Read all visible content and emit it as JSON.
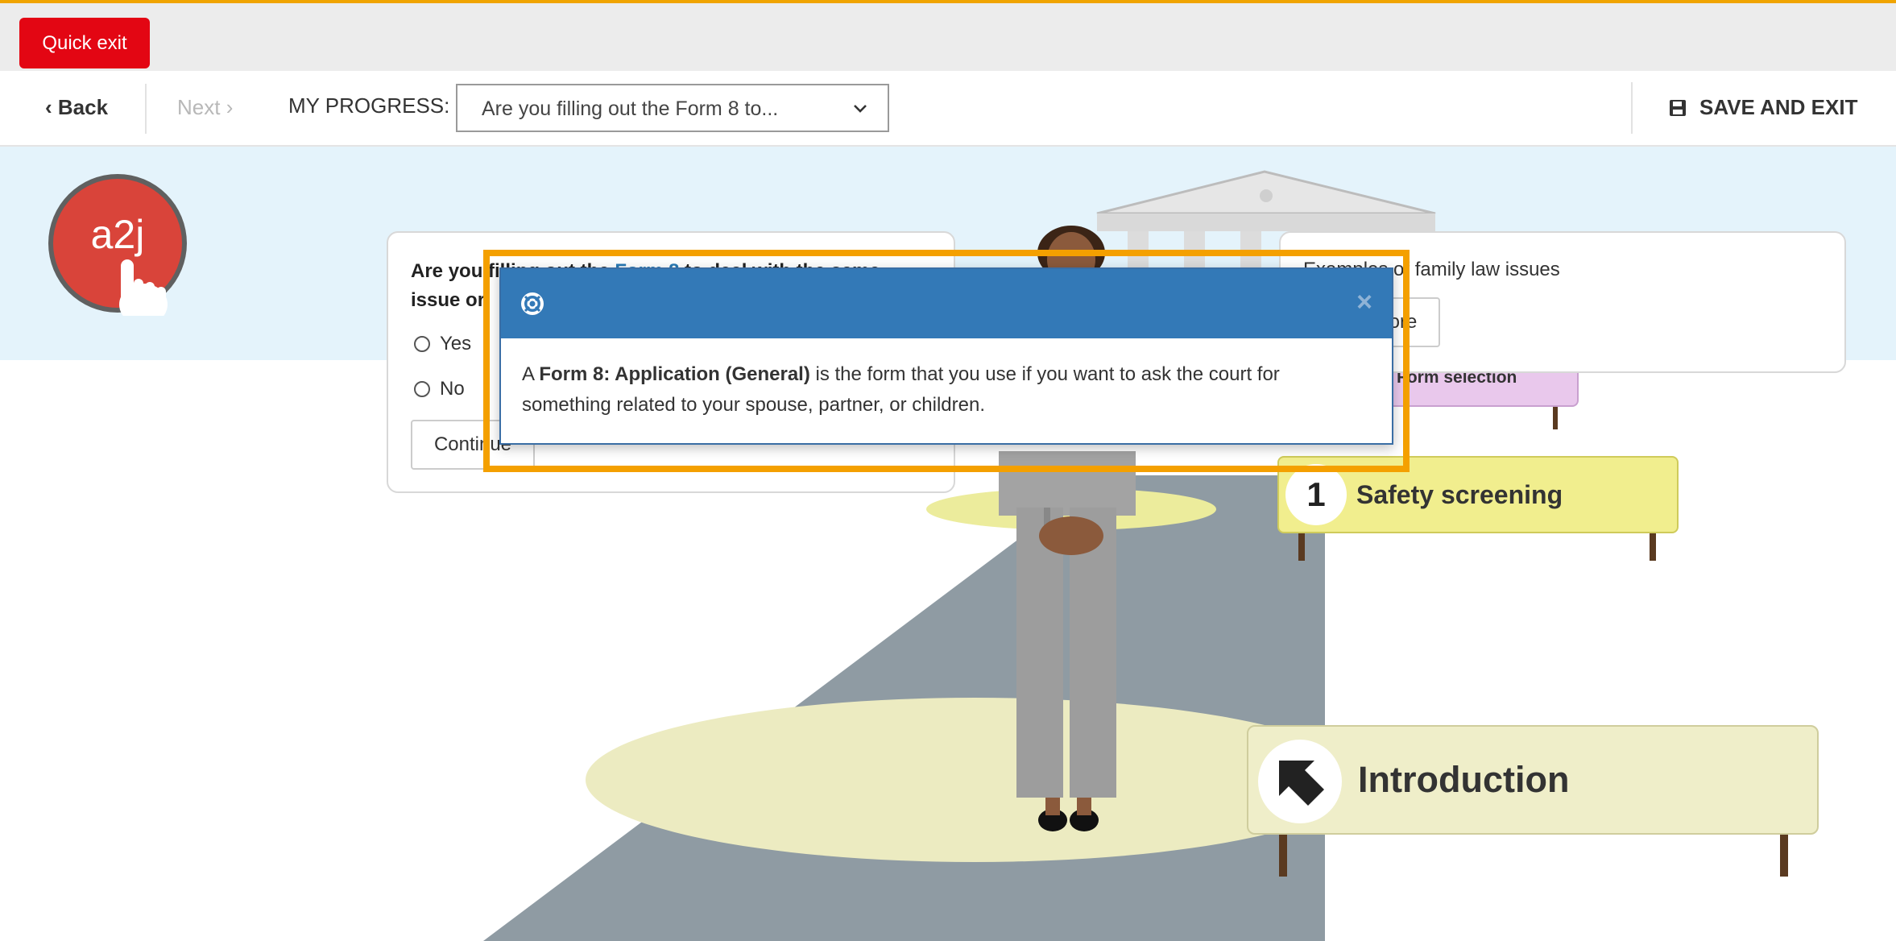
{
  "topbar": {
    "quick_exit_label": "Quick exit"
  },
  "nav": {
    "back_label": "Back",
    "next_label": "Next",
    "progress_label": "MY PROGRESS:",
    "progress_selected": "Are you filling out the Form 8 to...",
    "save_exit_label": "SAVE AND EXIT"
  },
  "logo": {
    "text": "a2j"
  },
  "question": {
    "text_prefix": "Are you filling out the ",
    "link_text": "Form 8",
    "text_suffix": " to deal with the same issue or",
    "options": [
      "Yes",
      "No"
    ],
    "continue_label": "Continue"
  },
  "examples": {
    "title": "Examples of family law issues",
    "more_label": "More"
  },
  "signs": {
    "form_selection": "Form selection",
    "safety_number": "1",
    "safety": "Safety screening",
    "intro": "Introduction"
  },
  "popup": {
    "body_prefix": "A ",
    "body_bold": "Form 8: Application (General)",
    "body_suffix": " is the form that you use if you want to ask the court for something related to your spouse, partner, or children.",
    "close_symbol": "×"
  },
  "colors": {
    "accent_orange": "#f4a000",
    "quick_exit_red": "#e30613",
    "popup_blue": "#3379b7",
    "light_blue_band": "#e4f3fb"
  },
  "icons": [
    "chevron-left-icon",
    "chevron-right-icon",
    "chevron-down-icon",
    "save-disk-icon",
    "help-lifebuoy-icon",
    "close-icon",
    "arrow-up-left-icon",
    "pointing-hand-icon"
  ]
}
